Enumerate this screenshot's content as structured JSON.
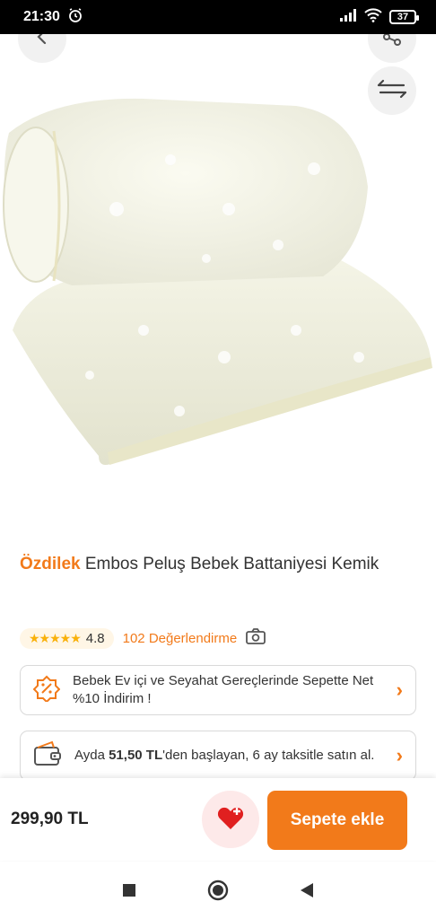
{
  "status_bar": {
    "time": "21:30",
    "battery": "37"
  },
  "product": {
    "brand": "Özdilek",
    "name": "Embos Peluş Bebek Battaniyesi Kemik",
    "rating": "4.8",
    "stars": "★★★★★",
    "reviews": "102 Değerlendirme"
  },
  "promo": {
    "text": "Bebek Ev içi ve Seyahat Gereçlerinde Sepette Net %10 İndirim !"
  },
  "installment": {
    "prefix": "Ayda ",
    "amount": "51,50 TL",
    "suffix": "'den başlayan, 6 ay taksitle satın al."
  },
  "bottom": {
    "price": "299,90 TL",
    "cart_label": "Sepete ekle"
  },
  "icons": {
    "back": "back-arrow-icon",
    "share": "share-icon",
    "compare": "compare-arrows-icon",
    "camera": "camera-icon",
    "favorite": "heart-icon"
  },
  "colors": {
    "accent": "#f27a1a",
    "star": "#f9b10b"
  }
}
